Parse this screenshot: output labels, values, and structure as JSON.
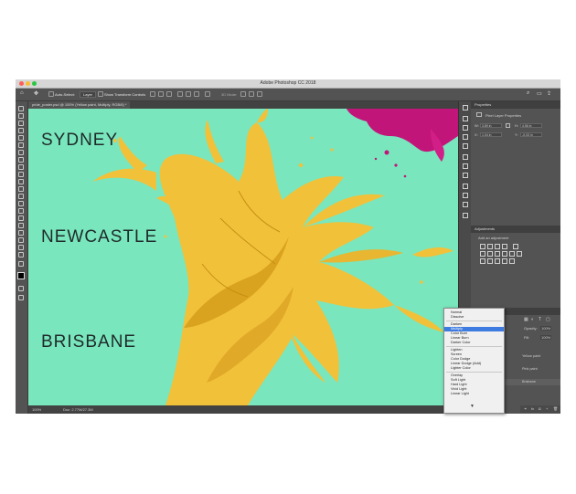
{
  "window": {
    "title": "Adobe Photoshop CC 2018"
  },
  "options_bar": {
    "auto_select_label": "Auto-Select:",
    "auto_select_value": "Layer",
    "show_transform_label": "Show Transform Controls",
    "mode_label": "3D Mode:"
  },
  "document": {
    "tab_title": "pride_poster.psd @ 100% (Yellow paint, Multiply, RGB/8) *"
  },
  "canvas": {
    "background": "#79e6bd",
    "paint_color": "#f2c13a",
    "splash_color": "#c2157a",
    "text_color": "#1f2a2a",
    "cities": [
      "SYDNEY",
      "NEWCASTLE",
      "BRISBANE"
    ]
  },
  "status": {
    "zoom": "100%",
    "doc_size": "Doc: 2.77M/27.3M"
  },
  "properties_panel": {
    "title": "Properties",
    "subtitle": "Pixel Layer Properties",
    "w_label": "W:",
    "w_value": "3.89 in",
    "h_label": "H:",
    "h_value": "4.56 in",
    "x_label": "X:",
    "x_value": "1.04 in",
    "y_label": "Y:",
    "y_value": "-0.03 in"
  },
  "adjustments_panel": {
    "title": "Adjustments",
    "subtitle": "Add an adjustment"
  },
  "layers_panel": {
    "opacity_label": "Opacity:",
    "opacity_value": "100%",
    "fill_label": "Fill:",
    "fill_value": "100%",
    "rows": [
      "Yellow paint",
      "Pink paint",
      "Brisbane"
    ]
  },
  "blend_menu": {
    "items": [
      "Normal",
      "Dissolve",
      "Darken",
      "Multiply",
      "Color Burn",
      "Linear Burn",
      "Darker Color",
      "Lighten",
      "Screen",
      "Color Dodge",
      "Linear Dodge (Add)",
      "Lighter Color",
      "Overlay",
      "Soft Light",
      "Hard Light",
      "Vivid Light",
      "Linear Light"
    ],
    "selected": "Multiply"
  }
}
